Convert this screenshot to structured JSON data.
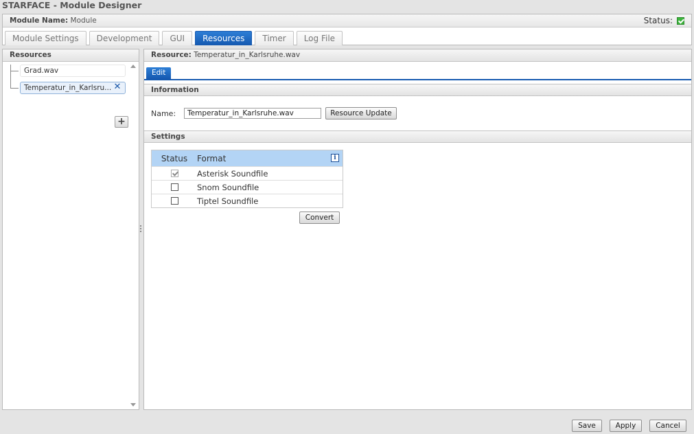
{
  "window": {
    "title": "STARFACE - Module Designer"
  },
  "module": {
    "name_label": "Module Name:",
    "name_value": "Module",
    "status_label": "Status:",
    "status_ok": true
  },
  "tabs": [
    {
      "label": "Module Settings",
      "active": false
    },
    {
      "label": "Development",
      "active": false
    },
    {
      "label": "GUI",
      "active": false
    },
    {
      "label": "Resources",
      "active": true
    },
    {
      "label": "Timer",
      "active": false
    },
    {
      "label": "Log File",
      "active": false
    }
  ],
  "resources_panel": {
    "title": "Resources",
    "items": [
      {
        "label": "Grad.wav",
        "selected": false
      },
      {
        "label": "Temperatur_in_Karlsru...",
        "selected": true
      }
    ],
    "add_icon": "plus-icon"
  },
  "resource_detail": {
    "title_label": "Resource:",
    "title_value": "Temperatur_in_Karlsruhe.wav",
    "edit_tab": "Edit",
    "information": {
      "title": "Information",
      "name_label": "Name:",
      "name_value": "Temperatur_in_Karlsruhe.wav",
      "update_button": "Resource Update"
    },
    "settings": {
      "title": "Settings",
      "columns": [
        "Status",
        "Format"
      ],
      "rows": [
        {
          "checked": true,
          "format": "Asterisk Soundfile"
        },
        {
          "checked": false,
          "format": "Snom Soundfile"
        },
        {
          "checked": false,
          "format": "Tiptel Soundfile"
        }
      ],
      "convert_button": "Convert"
    }
  },
  "footer": {
    "save": "Save",
    "apply": "Apply",
    "cancel": "Cancel"
  }
}
